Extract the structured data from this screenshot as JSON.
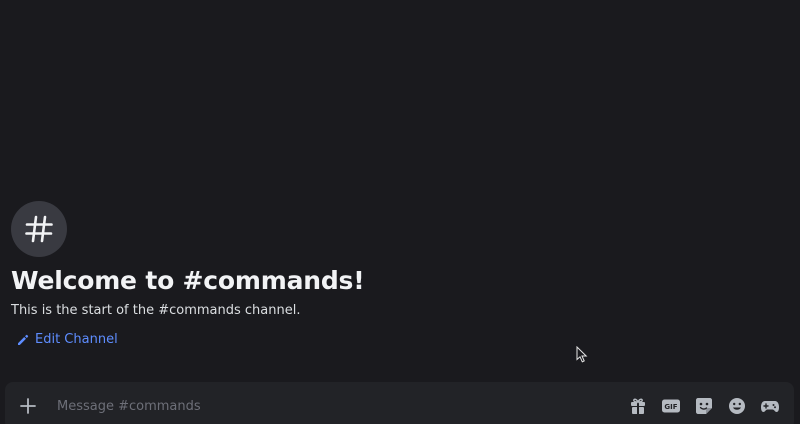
{
  "channel": {
    "avatar_symbol": "#",
    "welcome_title": "Welcome to #commands!",
    "welcome_subtitle": "This is the start of the #commands channel.",
    "edit_label": "Edit Channel"
  },
  "composer": {
    "placeholder": "Message #commands",
    "value": "",
    "icons": [
      "add-icon",
      "gift-icon",
      "gif-icon",
      "sticker-icon",
      "emoji-icon",
      "gamepad-icon"
    ]
  },
  "colors": {
    "background": "#1a1a1e",
    "composer_background": "#222327",
    "avatar_background": "#393a41",
    "title": "#f2f3f5",
    "text": "#dbdee1",
    "link": "#5e8dff",
    "muted": "#b5bac1"
  }
}
